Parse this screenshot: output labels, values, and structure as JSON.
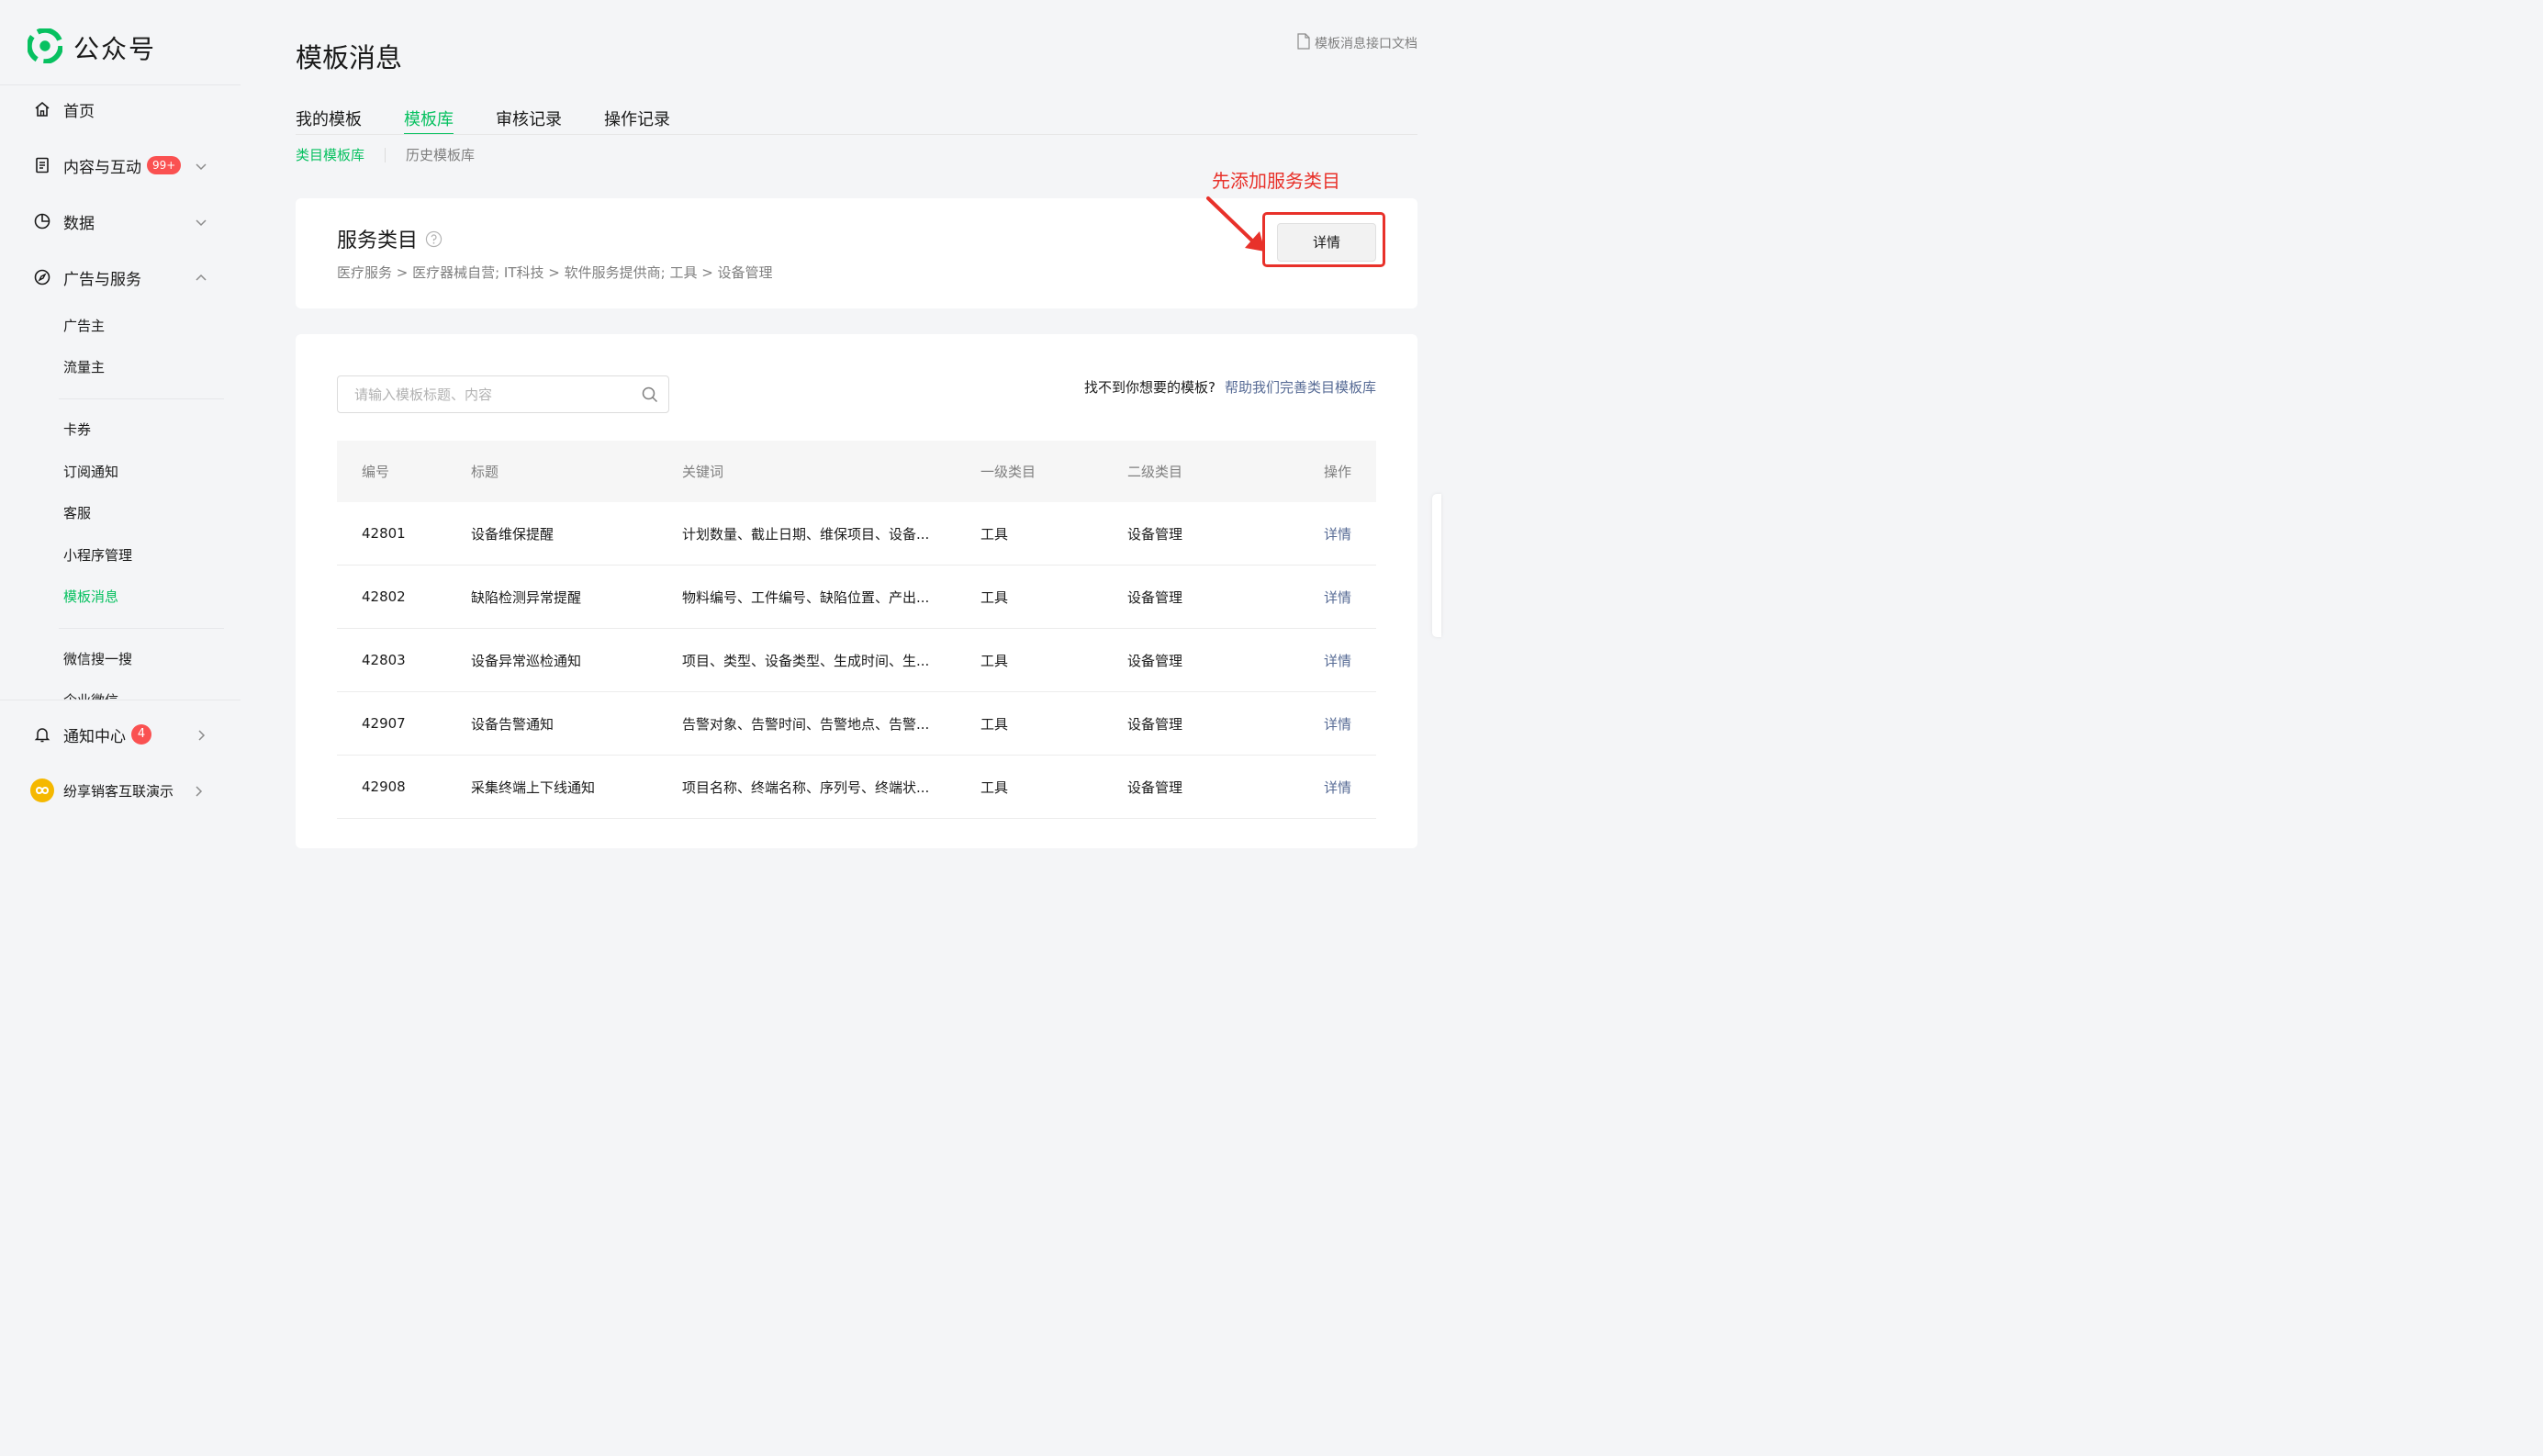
{
  "brand": {
    "name": "公众号"
  },
  "sidebar": {
    "main_items": [
      {
        "label": "首页"
      },
      {
        "label": "内容与互动",
        "badge": "99+"
      },
      {
        "label": "数据"
      },
      {
        "label": "广告与服务"
      }
    ],
    "sub_items": [
      "广告主",
      "流量主",
      "卡券",
      "订阅通知",
      "客服",
      "小程序管理",
      "模板消息",
      "微信搜一搜",
      "企业微信"
    ],
    "active_sub": "模板消息",
    "notification": {
      "label": "通知中心",
      "badge": "4"
    },
    "account": {
      "label": "纷享销客互联演示"
    }
  },
  "header": {
    "title": "模板消息",
    "doc_link": "模板消息接口文档"
  },
  "tabs": [
    "我的模板",
    "模板库",
    "审核记录",
    "操作记录"
  ],
  "active_tab": "模板库",
  "subtabs": [
    "类目模板库",
    "历史模板库"
  ],
  "active_subtab": "类目模板库",
  "service_category": {
    "title": "服务类目",
    "path": "医疗服务 > 医疗器械自营; IT科技 > 软件服务提供商; 工具 > 设备管理",
    "detail_button": "详情"
  },
  "annotation": {
    "text": "先添加服务类目"
  },
  "search": {
    "placeholder": "请输入模板标题、内容",
    "value": ""
  },
  "help": {
    "question": "找不到你想要的模板?",
    "link": "帮助我们完善类目模板库"
  },
  "table": {
    "columns": [
      "编号",
      "标题",
      "关键词",
      "一级类目",
      "二级类目",
      "操作"
    ],
    "rows": [
      {
        "id": "42801",
        "title": "设备维保提醒",
        "keywords": "计划数量、截止日期、维保项目、设备...",
        "cat1": "工具",
        "cat2": "设备管理",
        "action": "详情"
      },
      {
        "id": "42802",
        "title": "缺陷检测异常提醒",
        "keywords": "物料编号、工件编号、缺陷位置、产出...",
        "cat1": "工具",
        "cat2": "设备管理",
        "action": "详情"
      },
      {
        "id": "42803",
        "title": "设备异常巡检通知",
        "keywords": "项目、类型、设备类型、生成时间、生...",
        "cat1": "工具",
        "cat2": "设备管理",
        "action": "详情"
      },
      {
        "id": "42907",
        "title": "设备告警通知",
        "keywords": "告警对象、告警时间、告警地点、告警...",
        "cat1": "工具",
        "cat2": "设备管理",
        "action": "详情"
      },
      {
        "id": "42908",
        "title": "采集终端上下线通知",
        "keywords": "项目名称、终端名称、序列号、终端状...",
        "cat1": "工具",
        "cat2": "设备管理",
        "action": "详情"
      }
    ]
  },
  "colors": {
    "brand_green": "#07c160",
    "link_blue": "#576b95",
    "badge_red": "#fa5151",
    "annotation_red": "#e8312a"
  },
  "icons": {
    "brand": "wechat-official-logo",
    "home": "home-icon",
    "content": "document-icon",
    "data": "pie-chart-icon",
    "ads": "compass-icon",
    "notify": "bell-icon",
    "search": "search-icon",
    "help": "question-circle-icon",
    "doc": "file-icon"
  }
}
